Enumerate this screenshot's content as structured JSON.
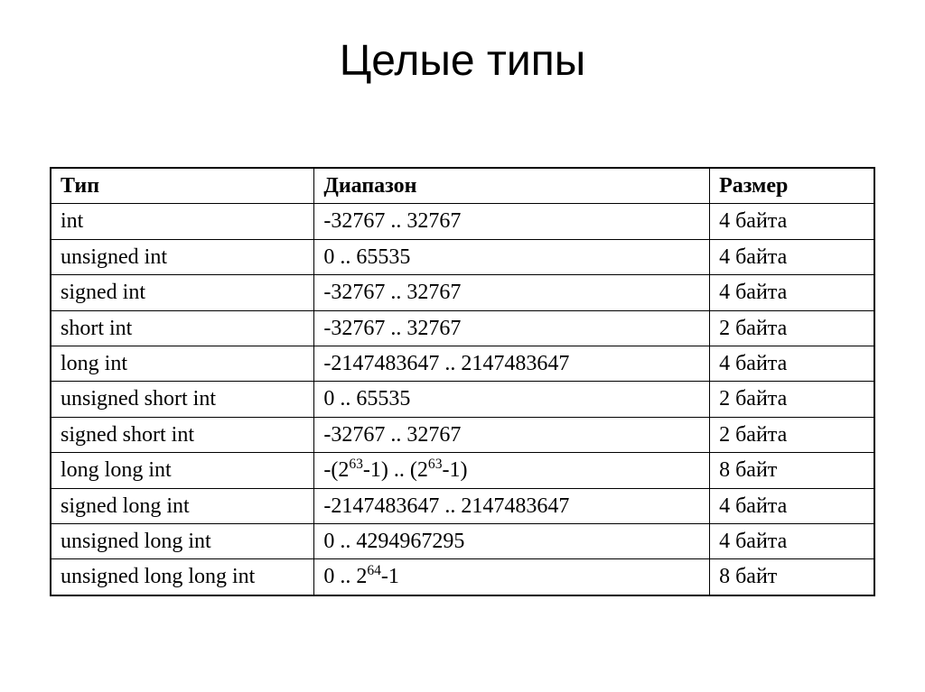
{
  "title": "Целые типы",
  "headers": {
    "type": "Тип",
    "range": "Диапазон",
    "size": "Размер"
  },
  "rows": [
    {
      "type": "int",
      "range": "-32767 .. 32767",
      "size": "4 байта"
    },
    {
      "type": "unsigned int",
      "range": "0 .. 65535",
      "size": "4 байта"
    },
    {
      "type": "signed int",
      "range": "-32767 .. 32767",
      "size": "4 байта"
    },
    {
      "type": "short int",
      "range": "-32767 .. 32767",
      "size": "2 байта"
    },
    {
      "type": "long int",
      "range": "-2147483647 .. 2147483647",
      "size": "4 байта"
    },
    {
      "type": "unsigned short int",
      "range": "0 .. 65535",
      "size": "2 байта"
    },
    {
      "type": "signed short int",
      "range": "-32767 .. 32767",
      "size": "2 байта"
    },
    {
      "type": "long long int",
      "range": "-(2^63^-1) .. (2^63^-1)",
      "size": "8 байт"
    },
    {
      "type": "signed long int",
      "range": "-2147483647 .. 2147483647",
      "size": "4 байта"
    },
    {
      "type": "unsigned long int",
      "range": "0 .. 4294967295",
      "size": "4 байта"
    },
    {
      "type": "unsigned long long int",
      "range": "0 .. 2^64^-1",
      "size": "8 байт"
    }
  ]
}
